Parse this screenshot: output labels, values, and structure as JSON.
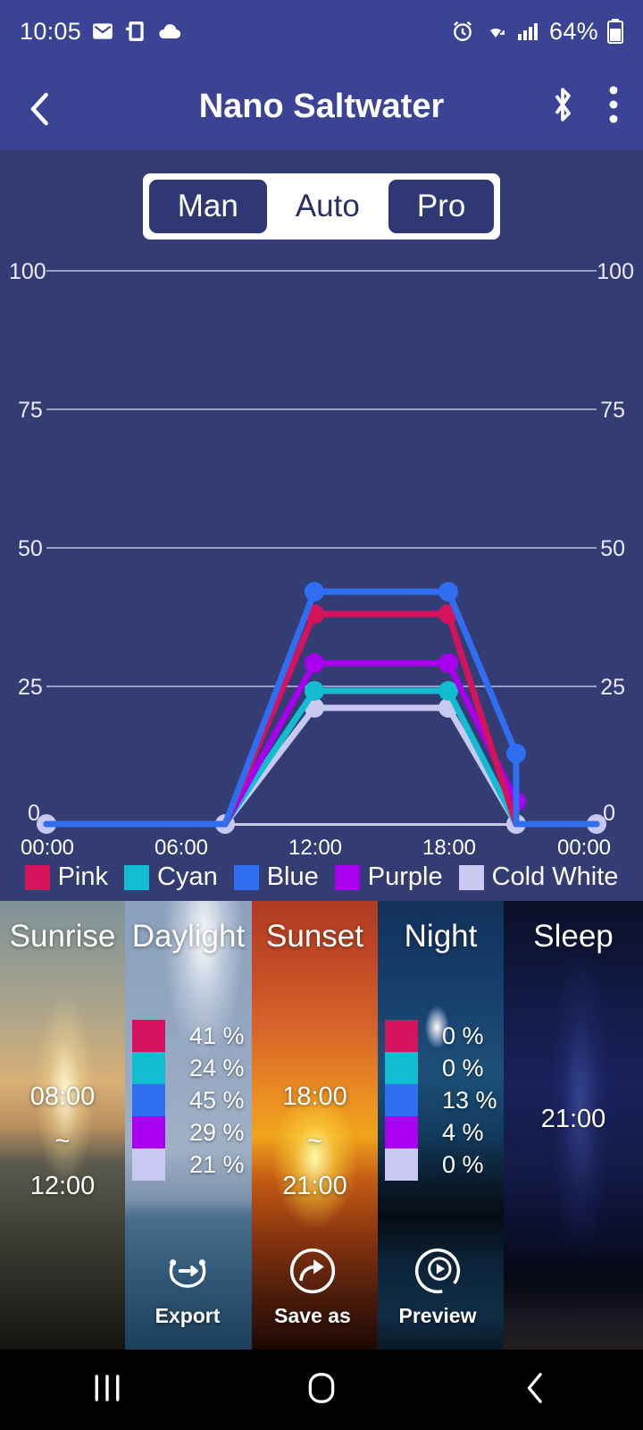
{
  "status_bar": {
    "time": "10:05",
    "battery_percent": "64%",
    "icons": [
      "mail-icon",
      "sim-card-icon",
      "cloud-icon",
      "alarm-icon",
      "wifi-icon",
      "signal-icon",
      "battery-icon"
    ]
  },
  "app_bar": {
    "title": "Nano Saltwater",
    "back_icon": "back-chevron-icon",
    "bluetooth_icon": "bluetooth-icon",
    "overflow_icon": "more-vertical-icon"
  },
  "mode_tabs": {
    "items": [
      {
        "label": "Man",
        "selected": false
      },
      {
        "label": "Auto",
        "selected": true
      },
      {
        "label": "Pro",
        "selected": false
      }
    ]
  },
  "chart_data": {
    "type": "line",
    "title": "",
    "xlabel": "",
    "ylabel": "",
    "ylim": [
      0,
      100
    ],
    "yticks": [
      0,
      25,
      50,
      75,
      100
    ],
    "xticks": [
      "00:00",
      "06:00",
      "12:00",
      "18:00",
      "00:00"
    ],
    "x_hours": [
      0,
      6,
      12,
      18,
      24
    ],
    "grid": true,
    "legend_position": "bottom",
    "series": [
      {
        "name": "Pink",
        "color": "#d5125c",
        "x": [
          0,
          8,
          12,
          18,
          21,
          24
        ],
        "values": [
          0,
          0,
          41,
          41,
          0,
          0
        ]
      },
      {
        "name": "Cyan",
        "color": "#12bdd1",
        "x": [
          0,
          8,
          12,
          18,
          21,
          24
        ],
        "values": [
          0,
          0,
          24,
          24,
          0,
          0
        ]
      },
      {
        "name": "Blue",
        "color": "#2f6ef0",
        "x": [
          0,
          8,
          12,
          18,
          21,
          24
        ],
        "values": [
          0,
          0,
          45,
          45,
          13,
          0
        ]
      },
      {
        "name": "Purple",
        "color": "#a800ee",
        "x": [
          0,
          8,
          12,
          18,
          21,
          24
        ],
        "values": [
          0,
          0,
          29,
          29,
          4,
          0
        ]
      },
      {
        "name": "Cold White",
        "color": "#c8c8f0",
        "x": [
          0,
          8,
          12,
          18,
          21,
          24
        ],
        "values": [
          0,
          0,
          21,
          21,
          0,
          0
        ]
      }
    ]
  },
  "cards": [
    {
      "name": "sunrise",
      "title": "Sunrise",
      "time_start": "08:00",
      "time_sep": "~",
      "time_end": "12:00",
      "has_swatches": false
    },
    {
      "name": "daylight",
      "title": "Daylight",
      "has_swatches": true,
      "swatches": [
        {
          "color": "#d5125c",
          "value": "41 %"
        },
        {
          "color": "#12bdd1",
          "value": "24 %"
        },
        {
          "color": "#2f6ef0",
          "value": "45 %"
        },
        {
          "color": "#a800ee",
          "value": "29 %"
        },
        {
          "color": "#c8c8f0",
          "value": "21 %"
        }
      ]
    },
    {
      "name": "sunset",
      "title": "Sunset",
      "time_start": "18:00",
      "time_sep": "~",
      "time_end": "21:00",
      "has_swatches": false
    },
    {
      "name": "night",
      "title": "Night",
      "has_swatches": true,
      "swatches": [
        {
          "color": "#d5125c",
          "value": "0 %"
        },
        {
          "color": "#12bdd1",
          "value": "0 %"
        },
        {
          "color": "#2f6ef0",
          "value": "13 %"
        },
        {
          "color": "#a800ee",
          "value": "4 %"
        },
        {
          "color": "#c8c8f0",
          "value": "0 %"
        }
      ]
    },
    {
      "name": "sleep",
      "title": "Sleep",
      "time_start": "21:00",
      "has_swatches": false
    }
  ],
  "actions": [
    {
      "label": "Export",
      "icon": "export-circular-arrow-icon"
    },
    {
      "label": "Save as",
      "icon": "share-arrow-icon"
    },
    {
      "label": "Preview",
      "icon": "play-circle-icon"
    }
  ],
  "nav_bar": {
    "recents_icon": "recents-icon",
    "home_icon": "home-icon",
    "back_icon": "nav-back-icon"
  },
  "colors": {
    "brand_blue": "#3b4395",
    "panel_bg": "#343c74",
    "pink": "#d5125c",
    "cyan": "#12bdd1",
    "blue": "#2f6ef0",
    "purple": "#a800ee",
    "cold_white": "#c8c8f0"
  }
}
